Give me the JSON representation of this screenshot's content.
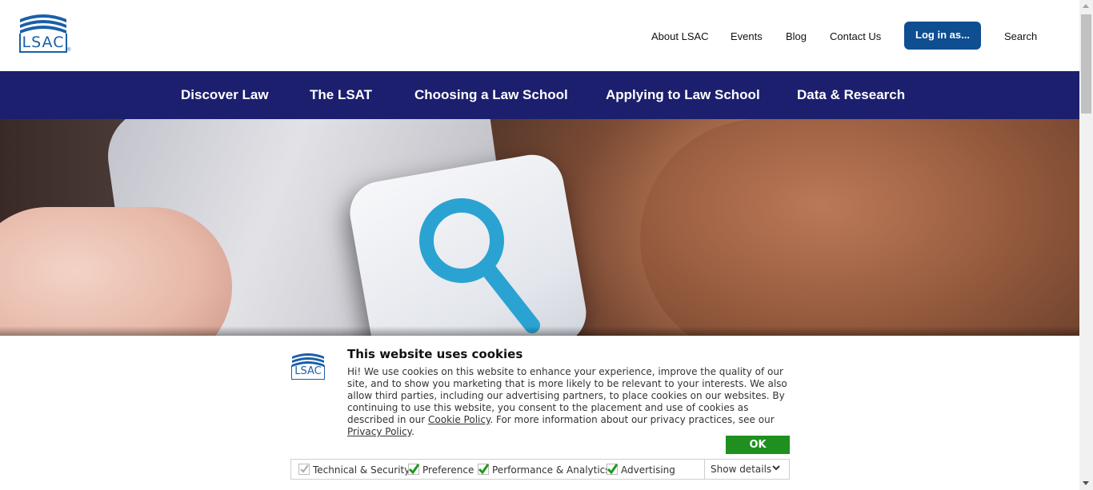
{
  "header": {
    "logo_text": "LSAC",
    "logo_mark": "®",
    "links": [
      "About LSAC",
      "Events",
      "Blog",
      "Contact Us"
    ],
    "login_label": "Log in as...",
    "search_label": "Search"
  },
  "main_nav": {
    "items": [
      "Discover Law",
      "The LSAT",
      "Choosing a Law School",
      "Applying to Law School",
      "Data & Research"
    ]
  },
  "hero": {
    "image": "magnifying-glass-app-icon-on-phone"
  },
  "cookie_banner": {
    "logo_text": "LSAC",
    "title": "This website uses cookies",
    "body_part1": "Hi! We use cookies on this website to enhance your experience, improve the quality of our site, and to show you marketing that is more likely to be relevant to your interests. We also allow third parties, including our advertising partners, to place cookies on our websites. By continuing to use this website, you consent to the placement and use of cookies as described in our ",
    "cookie_policy_link": "Cookie Policy",
    "body_part2": ". For more information about our privacy practices, see our ",
    "privacy_policy_link": "Privacy Policy",
    "body_part3": ".",
    "ok_label": "OK",
    "options": [
      {
        "label": "Technical & Security",
        "checked": true,
        "locked": true
      },
      {
        "label": "Preference",
        "checked": true,
        "locked": false
      },
      {
        "label": "Performance & Analytics",
        "checked": true,
        "locked": false
      },
      {
        "label": "Advertising",
        "checked": true,
        "locked": false
      }
    ],
    "show_details_label": "Show details"
  },
  "colors": {
    "nav_bg": "#1b1f6e",
    "brand_blue": "#0f4e91",
    "ok_green": "#1f8f1f",
    "check_green": "#1f9a1f"
  }
}
